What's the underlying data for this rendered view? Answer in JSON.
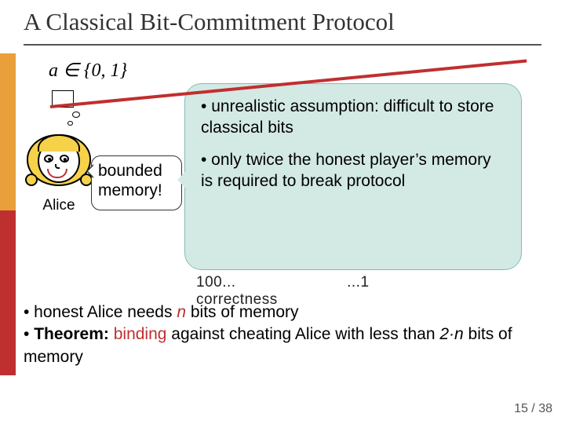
{
  "title": "A Classical Bit-Commitment Protocol",
  "formula": "a ∈ {0, 1}",
  "alice": {
    "label": "Alice"
  },
  "callout_mem": {
    "line1": "bounded",
    "line2": "memory!"
  },
  "callout_big": {
    "p1_prefix": "• ",
    "p1_em": "unrealistic",
    "p1_rest": " assumption: difficult to store classical bits",
    "p2_prefix": "• only ",
    "p2_em": "twice",
    "p2_rest": " the honest player’s memory is required to break protocol"
  },
  "fragment": {
    "left": "100...",
    "mid": "...1",
    "right": "correctness"
  },
  "bullets": {
    "b1_pre": "• honest Alice needs ",
    "b1_n": "n",
    "b1_post": " bits of memory",
    "b2_pre": "• ",
    "b2_thm": "Theorem:",
    "b2_sp": " ",
    "b2_bind": "binding",
    "b2_mid": " against cheating Alice with less than ",
    "b2_two_n": "2·n",
    "b2_post": " bits of memory"
  },
  "page": {
    "current": "15",
    "sep": " / ",
    "total": "38"
  }
}
